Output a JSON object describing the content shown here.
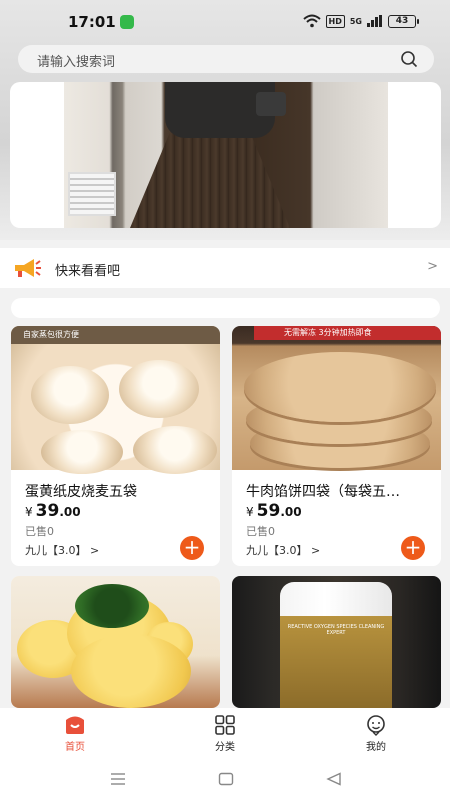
{
  "status_bar": {
    "time": "17:01",
    "hd": "HD",
    "network": "5G",
    "battery": "43"
  },
  "search": {
    "placeholder": "请输入搜索词"
  },
  "notice": {
    "text": "快来看看吧",
    "arrow": ">"
  },
  "products": [
    {
      "name": "蛋黄纸皮烧麦五袋",
      "currency": "¥",
      "price_int": "39",
      "price_dec": ".00",
      "sold": "已售0",
      "shop": "九儿【3.0】 >",
      "image_caption": "自家蒸包很方便"
    },
    {
      "name": "牛肉馅饼四袋（每袋五…",
      "currency": "¥",
      "price_int": "59",
      "price_dec": ".00",
      "sold": "已售0",
      "shop": "九儿【3.0】 >",
      "image_caption": "无需解冻 3分钟加热即食"
    },
    {
      "name": "",
      "image_caption": ""
    },
    {
      "name": "",
      "image_caption": "REACTIVE OXYGEN SPECIES CLEANING EXPERT"
    }
  ],
  "tabbar": {
    "home": "首页",
    "category": "分类",
    "mine": "我的"
  },
  "colors": {
    "accent": "#ee5a1a",
    "home_active": "#e8503a",
    "background": "#f2f2f2"
  }
}
